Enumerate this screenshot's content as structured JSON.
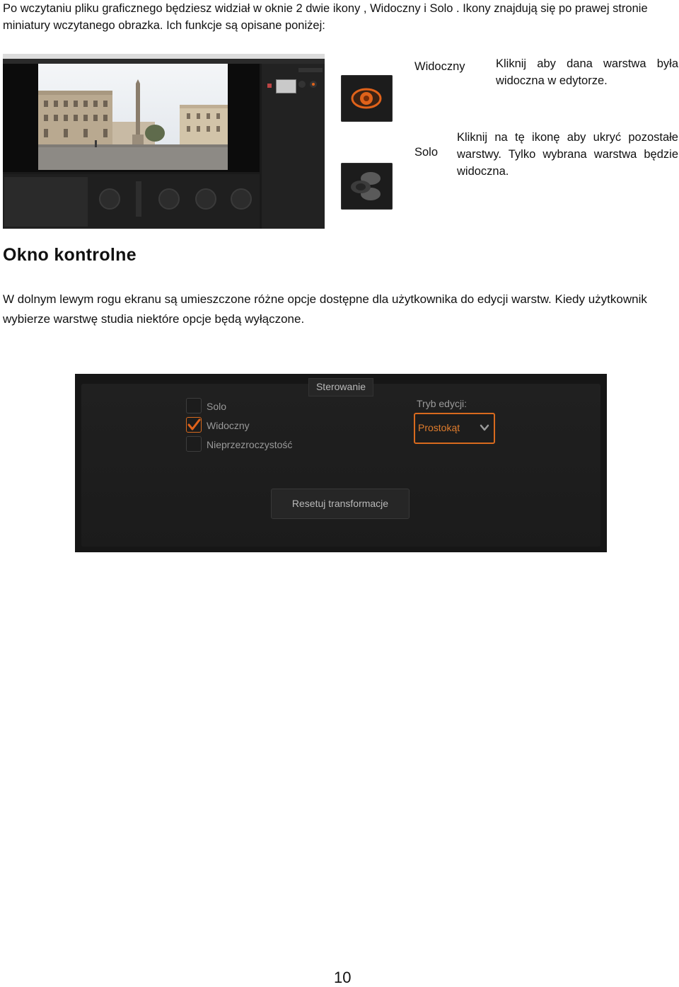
{
  "intro": "Po wczytaniu pliku graficznego będziesz widział w oknie 2 dwie ikony , Widoczny i Solo . Ikony znajdują się po prawej stronie miniatury wczytanego obrazka. Ich funkcje są opisane poniżej:",
  "icons": {
    "widoczny": {
      "label": "Widoczny",
      "description": "Kliknij aby dana warstwa była widoczna w edytorze.",
      "icon": "eye-icon",
      "color": "#e0621a"
    },
    "solo": {
      "label": "Solo",
      "description": "Kliknij na tę ikonę aby ukryć pozostałe warstwy. Tylko wybrana warstwa będzie widoczna.",
      "icon": "solo-icon"
    }
  },
  "section": {
    "heading": "Okno  kontrolne",
    "body": "W dolnym lewym rogu ekranu są umieszczone różne opcje dostępne dla użytkownika do edycji warstw. Kiedy użytkownik wybierze warstwę studia niektóre opcje będą wyłączone."
  },
  "control_panel": {
    "title": "Sterowanie",
    "checkboxes": [
      {
        "label": "Solo",
        "checked": false
      },
      {
        "label": "Widoczny",
        "checked": true
      },
      {
        "label": "Nieprzezroczystość",
        "checked": false
      }
    ],
    "mode_label": "Tryb edycji:",
    "mode_value": "Prostokąt",
    "reset_label": "Resetuj transformacje",
    "accent_color": "#d86a1e"
  },
  "page_number": "10"
}
